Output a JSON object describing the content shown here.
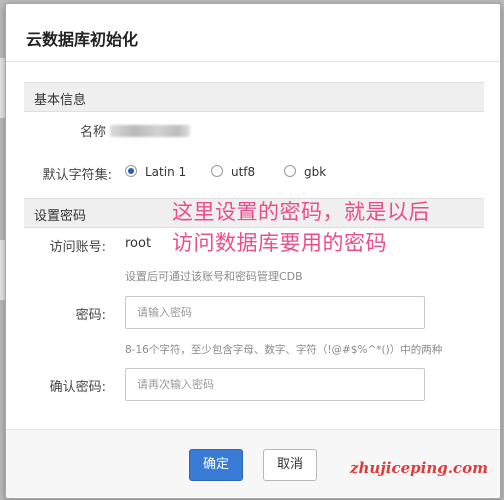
{
  "dialog": {
    "title": "云数据库初始化",
    "basic_section": "基本信息",
    "name_label": "名称",
    "charset_label": "默认字符集:",
    "charset_options": [
      {
        "label": "Latin 1",
        "selected": true
      },
      {
        "label": "utf8",
        "selected": false
      },
      {
        "label": "gbk",
        "selected": false
      }
    ],
    "password_section": "设置密码",
    "account_label": "访问账号:",
    "account_value": "root",
    "account_hint": "设置后可通过该账号和密码管理CDB",
    "password_label": "密码:",
    "password_placeholder": "请输入密码",
    "password_hint": "8-16个字符，至少包含字母、数字、字符（!@#$%^*()）中的两种",
    "confirm_label": "确认密码:",
    "confirm_placeholder": "请再次输入密码",
    "ok_button": "确定",
    "cancel_button": "取消"
  },
  "annotation": {
    "line1": "这里设置的密码，就是以后",
    "line2": "访问数据库要用的密码"
  },
  "watermark": "zhujiceping.com",
  "colors": {
    "accent": "#3a7bd5",
    "annotation": "#ea4e8b",
    "watermark": "#e03a3a"
  }
}
